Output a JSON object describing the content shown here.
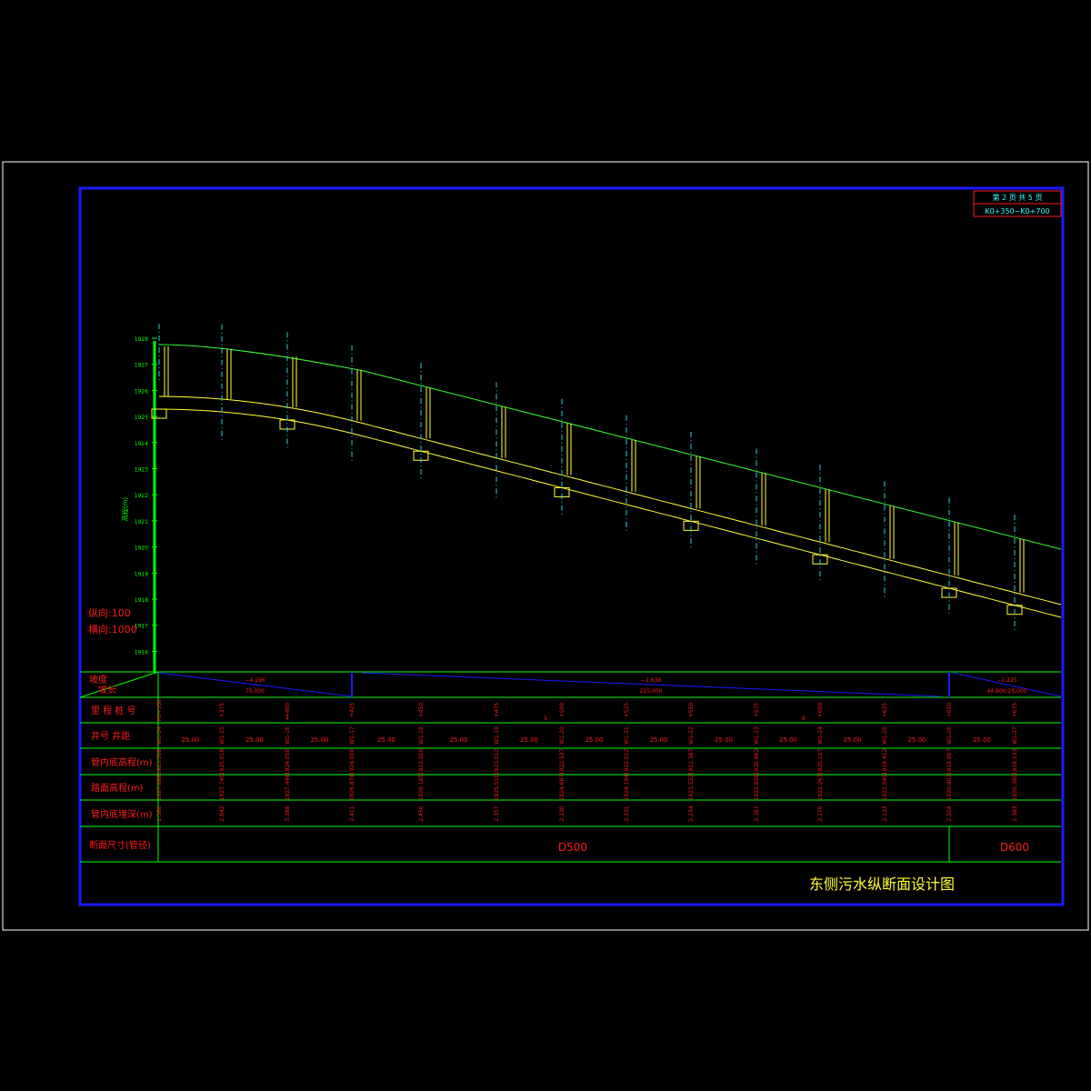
{
  "sheet": {
    "page_label": "第 2 页   共 5 页",
    "range_label": "K0+350~K0+700"
  },
  "scale": {
    "vertical_label": "纵向:100",
    "horizontal_label": "横向:1000"
  },
  "axis": {
    "ylabel": "高程(m)",
    "ticks": [
      "1928",
      "1927",
      "1926",
      "1925",
      "1924",
      "1923",
      "1922",
      "1921",
      "1920",
      "1919",
      "1918",
      "1917",
      "1916"
    ]
  },
  "table_rows": {
    "slope_top": "坡度",
    "slope_bottom": "坡长",
    "station": "里 程 桩 号",
    "well": "井号    井距",
    "invert": "管内底高程(m)",
    "ground": "路面高程(m)",
    "depth": "管内底埋深(m)",
    "pipe_size": "断面尺寸(管径)"
  },
  "slopes": [
    {
      "grade": "−4.196",
      "length": "75.000"
    },
    {
      "grade": "−2.638",
      "length": "225.000"
    },
    {
      "grade": "−2.225",
      "length": "44.800/25.000"
    }
  ],
  "stations": [
    "K0+350",
    "+375",
    "+400",
    "+425",
    "+450",
    "+475",
    "+500",
    "+525",
    "+550",
    "+575",
    "+600",
    "+625",
    "+650",
    "+675",
    "+700"
  ],
  "station_marks": [
    "4",
    "5",
    "6"
  ],
  "wells": [
    "W1-14",
    "W1-15",
    "W1-16",
    "W1-17",
    "W1-18",
    "W1-19",
    "W1-20",
    "W1-21",
    "W1-22",
    "W1-23",
    "W1-24",
    "W1-25",
    "W1-26",
    "W1-27"
  ],
  "spacings": [
    "25.00",
    "25.00",
    "25.00",
    "25.00",
    "25.00",
    "25.00",
    "25.00",
    "25.00",
    "25.00",
    "25.00",
    "25.00",
    "25.00",
    "25.00"
  ],
  "inverts": [
    "1925.508",
    "1925.018",
    "1924.050",
    "1924.000",
    "1923.500",
    "1923.012",
    "1922.537",
    "1922.012",
    "1921.387",
    "1920.862",
    "1920.107",
    "1919.412",
    "1918.997",
    "1918.133"
  ],
  "grounds": [
    "1927.888",
    "1927.740",
    "1927.448",
    "1926.874",
    "1926.185",
    "1925.510",
    "1924.687",
    "1924.194",
    "1923.522",
    "1922.829",
    "1922.267",
    "1921.545",
    "1920.802",
    "1920.380"
  ],
  "depths": [
    "2.380",
    "2.642",
    "3.388",
    "2.411",
    "2.450",
    "2.357",
    "2.230",
    "2.331",
    "2.234",
    "2.387",
    "2.170",
    "2.133",
    "2.504",
    "2.383"
  ],
  "pipe_sizes": [
    "D500",
    "D600"
  ],
  "title": "东侧污水纵断面设计图",
  "colors": {
    "frame": "#1a1aff",
    "grid": "#00ff00",
    "label_red": "#ff1a1a",
    "pipe": "#ffff33",
    "ground_line": "#33ff33",
    "well_axis": "#33ccdd",
    "title": "#ffff33",
    "sheet_text": "#33ffff"
  }
}
